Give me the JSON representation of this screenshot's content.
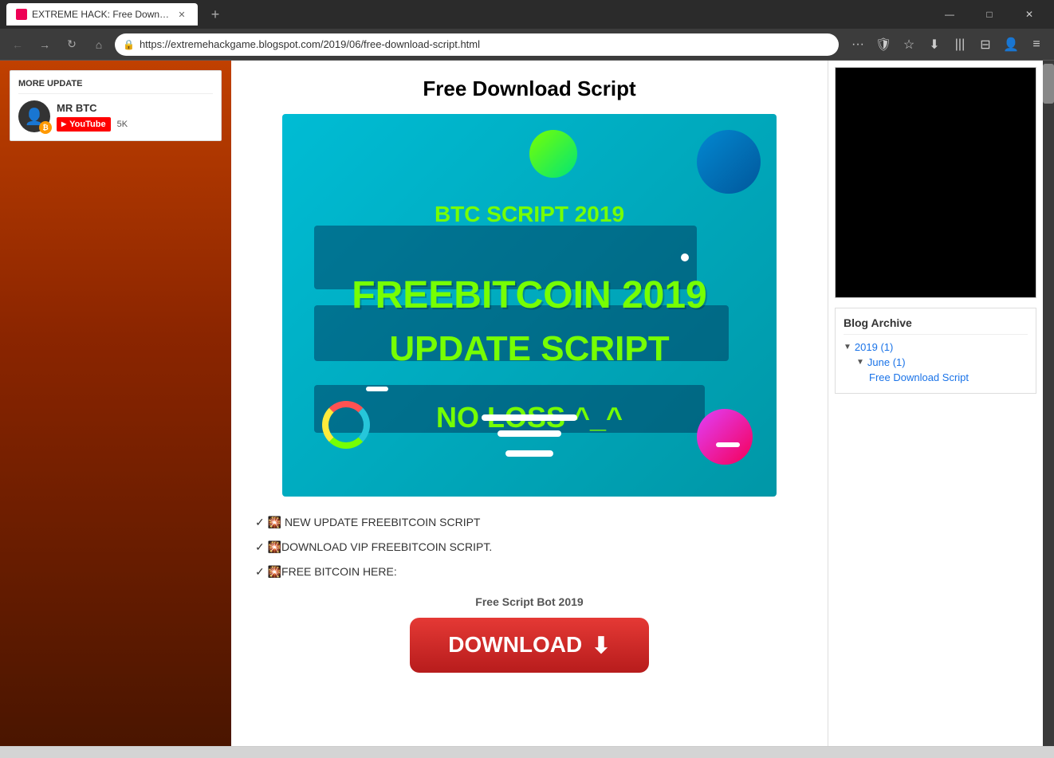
{
  "browser": {
    "tab": {
      "title": "EXTREME HACK: Free Downloa...",
      "favicon_color": "#cc0000"
    },
    "address": {
      "url": "https://extremehackgame.blogspot.com/2019/06/free-download-script.html",
      "secure": true
    },
    "window_controls": {
      "minimize": "—",
      "maximize": "□",
      "close": "✕"
    }
  },
  "sidebar_left": {
    "more_update_label": "MORE UPDATE",
    "author": {
      "name": "MR BTC",
      "avatar_icon": "👤",
      "btc_badge": "₿"
    },
    "youtube": {
      "label": "YouTube",
      "play_icon": "▶",
      "subscribers": "5K"
    }
  },
  "main_content": {
    "post_title": "Free Download Script",
    "image": {
      "text1": "BTC SCRIPT 2019",
      "text2": "FREEBITCOIN 2019",
      "text3": "UPDATE  SCRIPT",
      "text4": "NO LOSS ^_^"
    },
    "body_lines": [
      "✓ 🎇 NEW UPDATE FREEBITCOIN SCRIPT",
      "✓ 🎇DOWNLOAD VIP FREEBITCOIN SCRIPT.",
      "✓ 🎇FREE BITCOIN HERE:"
    ],
    "subheading": "Free Script Bot 2019",
    "download_button": {
      "label": "DOWNLOAD",
      "arrow": "⬇"
    }
  },
  "sidebar_right": {
    "blog_archive": {
      "title": "Blog Archive",
      "year": "2019 (1)",
      "month": "June (1)",
      "post": "Free Download Script"
    }
  }
}
